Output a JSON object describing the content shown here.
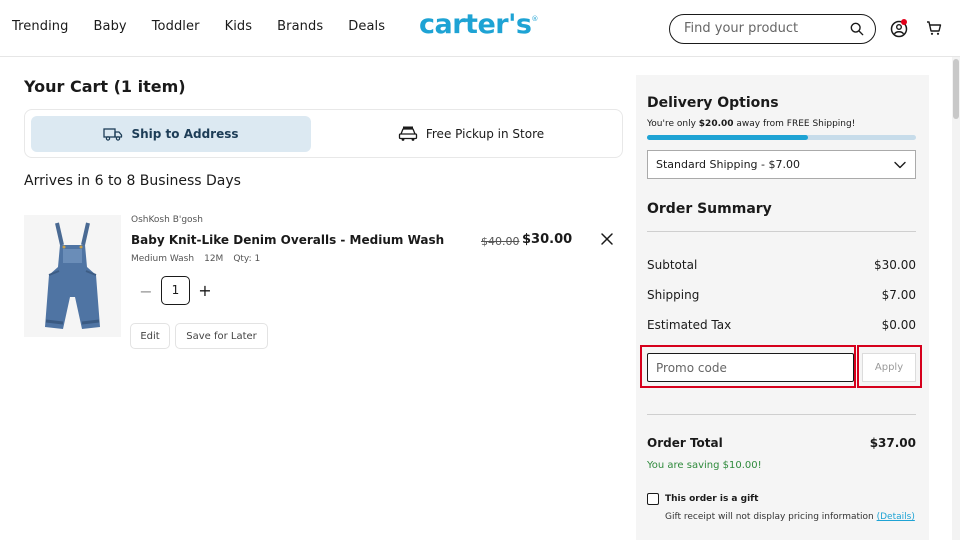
{
  "header": {
    "nav": [
      "Trending",
      "Baby",
      "Toddler",
      "Kids",
      "Brands",
      "Deals"
    ],
    "logo": "carter's",
    "logo_mark": "®",
    "search_placeholder": "Find your product",
    "brand_color": "#1ea3d4"
  },
  "cart": {
    "title": "Your Cart (1 item)",
    "ship_option": "Ship to Address",
    "pickup_option": "Free Pickup in Store",
    "arrives": "Arrives in 6 to 8 Business Days",
    "item": {
      "brand": "OshKosh B'gosh",
      "name": "Baby Knit-Like Denim Overalls - Medium Wash",
      "color": "Medium Wash",
      "size": "12M",
      "qty_label": "Qty: 1",
      "original_price": "$40.00",
      "price": "$30.00",
      "quantity": "1",
      "minus": "−",
      "plus": "+",
      "edit_label": "Edit",
      "save_label": "Save for Later"
    }
  },
  "summary": {
    "delivery_title": "Delivery Options",
    "free_msg_prefix": "You're only ",
    "free_msg_amount": "$20.00",
    "free_msg_suffix": " away from FREE Shipping!",
    "free_progress": 0.6,
    "shipping_select": "Standard Shipping - $7.00",
    "order_title": "Order Summary",
    "subtotal_label": "Subtotal",
    "subtotal": "$30.00",
    "shipping_label": "Shipping",
    "shipping": "$7.00",
    "tax_label": "Estimated Tax",
    "tax": "$0.00",
    "promo_placeholder": "Promo code",
    "apply_label": "Apply",
    "total_label": "Order Total",
    "total": "$37.00",
    "saving": "You are saving $10.00!",
    "gift_label": "This order is a gift",
    "gift_note": "Gift receipt will not display pricing information",
    "gift_details": "(Details)"
  }
}
